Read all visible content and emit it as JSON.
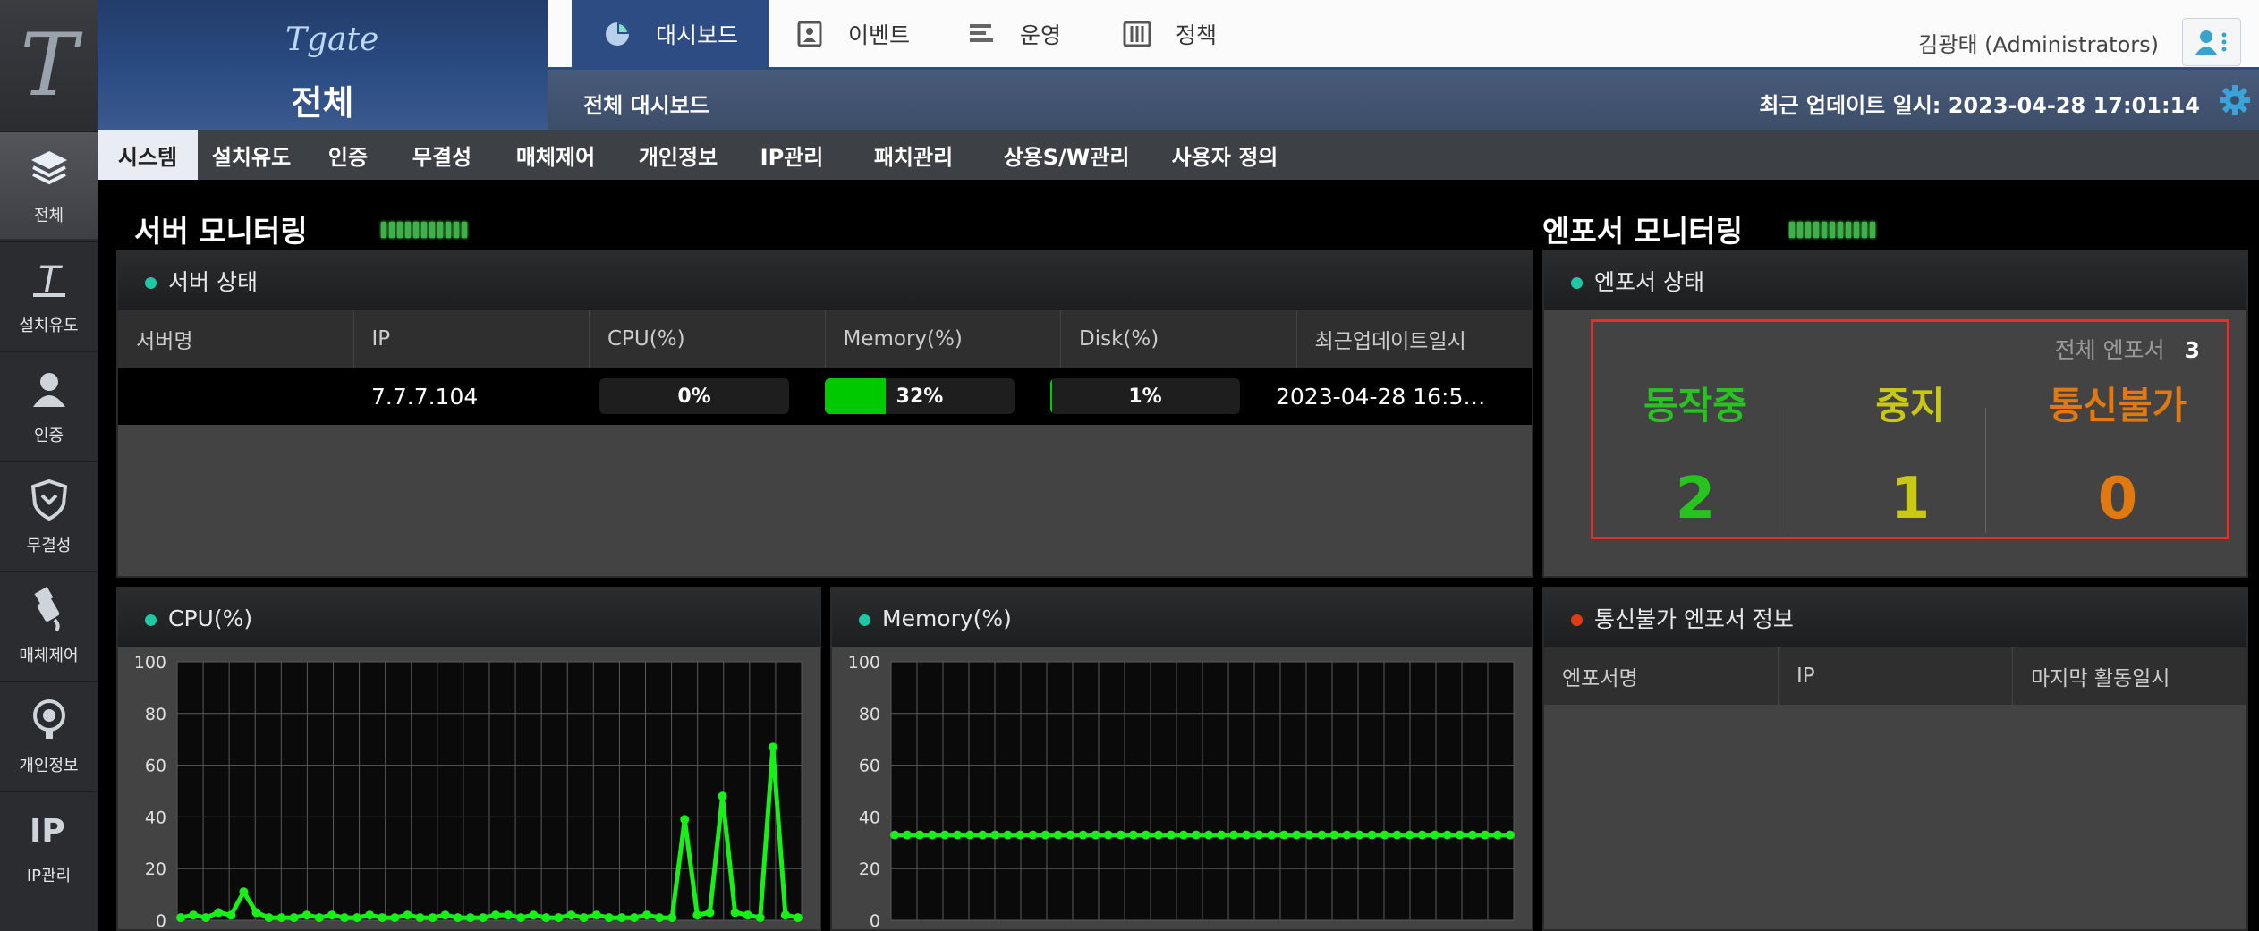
{
  "rail": {
    "items": [
      {
        "label": "전체",
        "icon": "layers-icon",
        "active": true
      },
      {
        "label": "설치유도",
        "icon": "install-logo-icon"
      },
      {
        "label": "인증",
        "icon": "user-icon"
      },
      {
        "label": "무결성",
        "icon": "shield-icon"
      },
      {
        "label": "매체제어",
        "icon": "usb-icon"
      },
      {
        "label": "개인정보",
        "icon": "privacy-icon"
      },
      {
        "label": "IP관리",
        "icon": "ip-icon"
      }
    ]
  },
  "brand": {
    "logo": "Tgate",
    "scope": "전체"
  },
  "topnav": {
    "tabs": [
      {
        "label": "대시보드",
        "icon": "pie-chart-icon",
        "active": true
      },
      {
        "label": "이벤트",
        "icon": "contact-card-icon"
      },
      {
        "label": "운영",
        "icon": "list-icon"
      },
      {
        "label": "정책",
        "icon": "sliders-icon"
      }
    ],
    "user": "김광태 (Administrators)"
  },
  "subhead": {
    "title": "전체 대시보드",
    "updated": "최근 업데이트 일시: 2023-04-28 17:01:14"
  },
  "subtabs": [
    "시스템",
    "설치유도",
    "인증",
    "무결성",
    "매체제어",
    "개인정보",
    "IP관리",
    "패치관리",
    "상용S/W관리",
    "사용자 정의"
  ],
  "server_monitoring": {
    "title": "서버 모니터링",
    "status_panel": {
      "title": "서버 상태",
      "columns": [
        "서버명",
        "IP",
        "CPU(%)",
        "Memory(%)",
        "Disk(%)",
        "최근업데이트일시"
      ],
      "rows": [
        {
          "name": "",
          "ip": "7.7.7.104",
          "cpu": 0,
          "cpu_label": "0%",
          "memory": 32,
          "memory_label": "32%",
          "disk": 1,
          "disk_label": "1%",
          "updated": "2023-04-28 16:5…"
        }
      ]
    }
  },
  "enforcer_monitoring": {
    "title": "엔포서 모니터링",
    "status_panel": {
      "title": "엔포서 상태",
      "total_label": "전체 엔포서",
      "total": "3",
      "stats": [
        {
          "label": "동작중",
          "value": "2",
          "color": "#27c31f"
        },
        {
          "label": "중지",
          "value": "1",
          "color": "#c9c914"
        },
        {
          "label": "통신불가",
          "value": "0",
          "color": "#e07a10"
        }
      ]
    },
    "offline_panel": {
      "title": "통신불가 엔포서 정보",
      "columns": [
        "엔포서명",
        "IP",
        "마지막 활동일시"
      ]
    }
  },
  "chart_data": [
    {
      "type": "line",
      "panel_title": "CPU(%)",
      "ylim": [
        0,
        100
      ],
      "yticks": [
        "0",
        "20",
        "40",
        "60",
        "80",
        "100"
      ],
      "color": "#19f019",
      "values": [
        1,
        2,
        1,
        3,
        2,
        11,
        3,
        1,
        1,
        1,
        2,
        1,
        2,
        1,
        1,
        2,
        1,
        1,
        2,
        1,
        1,
        2,
        1,
        1,
        1,
        2,
        2,
        1,
        2,
        1,
        1,
        2,
        1,
        2,
        1,
        1,
        1,
        2,
        1,
        1,
        39,
        2,
        3,
        48,
        3,
        2,
        1,
        67,
        2,
        1
      ]
    },
    {
      "type": "line",
      "panel_title": "Memory(%)",
      "ylim": [
        0,
        100
      ],
      "yticks": [
        "0",
        "20",
        "40",
        "60",
        "80",
        "100"
      ],
      "color": "#19f019",
      "values": [
        33,
        33,
        33,
        33,
        33,
        33,
        33,
        33,
        33,
        33,
        33,
        33,
        33,
        33,
        33,
        33,
        33,
        33,
        33,
        33,
        33,
        33,
        33,
        33,
        33,
        33,
        33,
        33,
        33,
        33,
        33,
        33,
        33,
        33,
        33,
        33,
        33,
        33,
        33,
        33,
        33,
        33,
        33,
        33,
        33,
        33,
        33,
        33,
        33,
        33
      ]
    }
  ]
}
